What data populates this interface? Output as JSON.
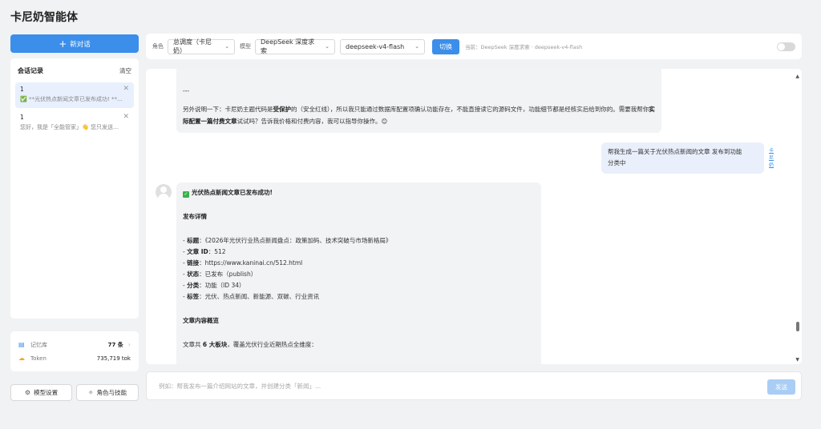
{
  "app": {
    "title": "卡尼奶智能体"
  },
  "sidebar": {
    "new_chat_label": "新对话",
    "history_title": "会话记录",
    "clear_label": "清空",
    "conversations": [
      {
        "num": "1",
        "preview": "✅ **光伏热点新闻文章已发布成功! **...",
        "active": true
      },
      {
        "num": "1",
        "preview": "您好，我是「全能管家」👋 您只发送了...",
        "active": false
      }
    ],
    "stats": {
      "memory_label": "记忆库",
      "memory_value": "77 条",
      "token_label": "Token",
      "token_value": "735,719 tok"
    },
    "model_settings_label": "模型设置",
    "roles_skills_label": "角色与技能"
  },
  "toolbar": {
    "role_label": "角色",
    "role_value": "总调度（卡尼奶）",
    "model_label": "模型",
    "provider_value": "DeepSeek 深度求索",
    "model_value": "deepseek-v4-flash",
    "switch_label": "切换",
    "current_text": "当前：DeepSeek 深度求索 · deepseek-v4-flash",
    "toggle_on": false
  },
  "chat": {
    "ai_msg_1": {
      "divider": "---",
      "p1": "另外说明一下：卡尼奶主题代码是",
      "b1": "受保护",
      "p2": "的（安全红线），所以我只能通过数据库配置项确认功能存在，不能直接读它的源码文件，功能细节都是经核实后给到你",
      "p3": "的。需要我帮你",
      "b2": "实际配置一篇付费文章",
      "p4": "试试吗？告诉我价格和付费内容，我可以指导你操作。",
      "emoji": "😊"
    },
    "user_msg": {
      "line1": "帮我生成一篇关于光伏热点新闻的文章 发布到功能",
      "line2": "分类中",
      "avatar_text": "卡尼奶"
    },
    "ai_msg_2": {
      "title": "光伏热点新闻文章已发布成功!",
      "details_title": "发布详情",
      "items": [
        {
          "key": "标题",
          "sep": "：",
          "value": "《2026年光伏行业热点新闻盘点：政策加码、技术突破与市场新格局》"
        },
        {
          "key": "文章 ID",
          "sep": "：",
          "value": "512"
        },
        {
          "key": "链接",
          "sep": "：",
          "value": "https://www.kaninai.cn/512.html"
        },
        {
          "key": "状态",
          "sep": "：",
          "value": "已发布（publish）"
        },
        {
          "key": "分类",
          "sep": "：",
          "value": "功能（ID 34）"
        },
        {
          "key": "标签",
          "sep": "：",
          "value": "光伏、热点新闻、新能源、双碳、行业资讯"
        }
      ],
      "overview_title": "文章内容概览",
      "overview_pre": "文章共 ",
      "overview_bold": "6 大板块",
      "overview_post": "，覆盖光伏行业近期热点全维度："
    }
  },
  "input": {
    "placeholder": "例如：帮我发布一篇介绍网站的文章，并创建分类「新闻」...",
    "send_label": "发送"
  }
}
